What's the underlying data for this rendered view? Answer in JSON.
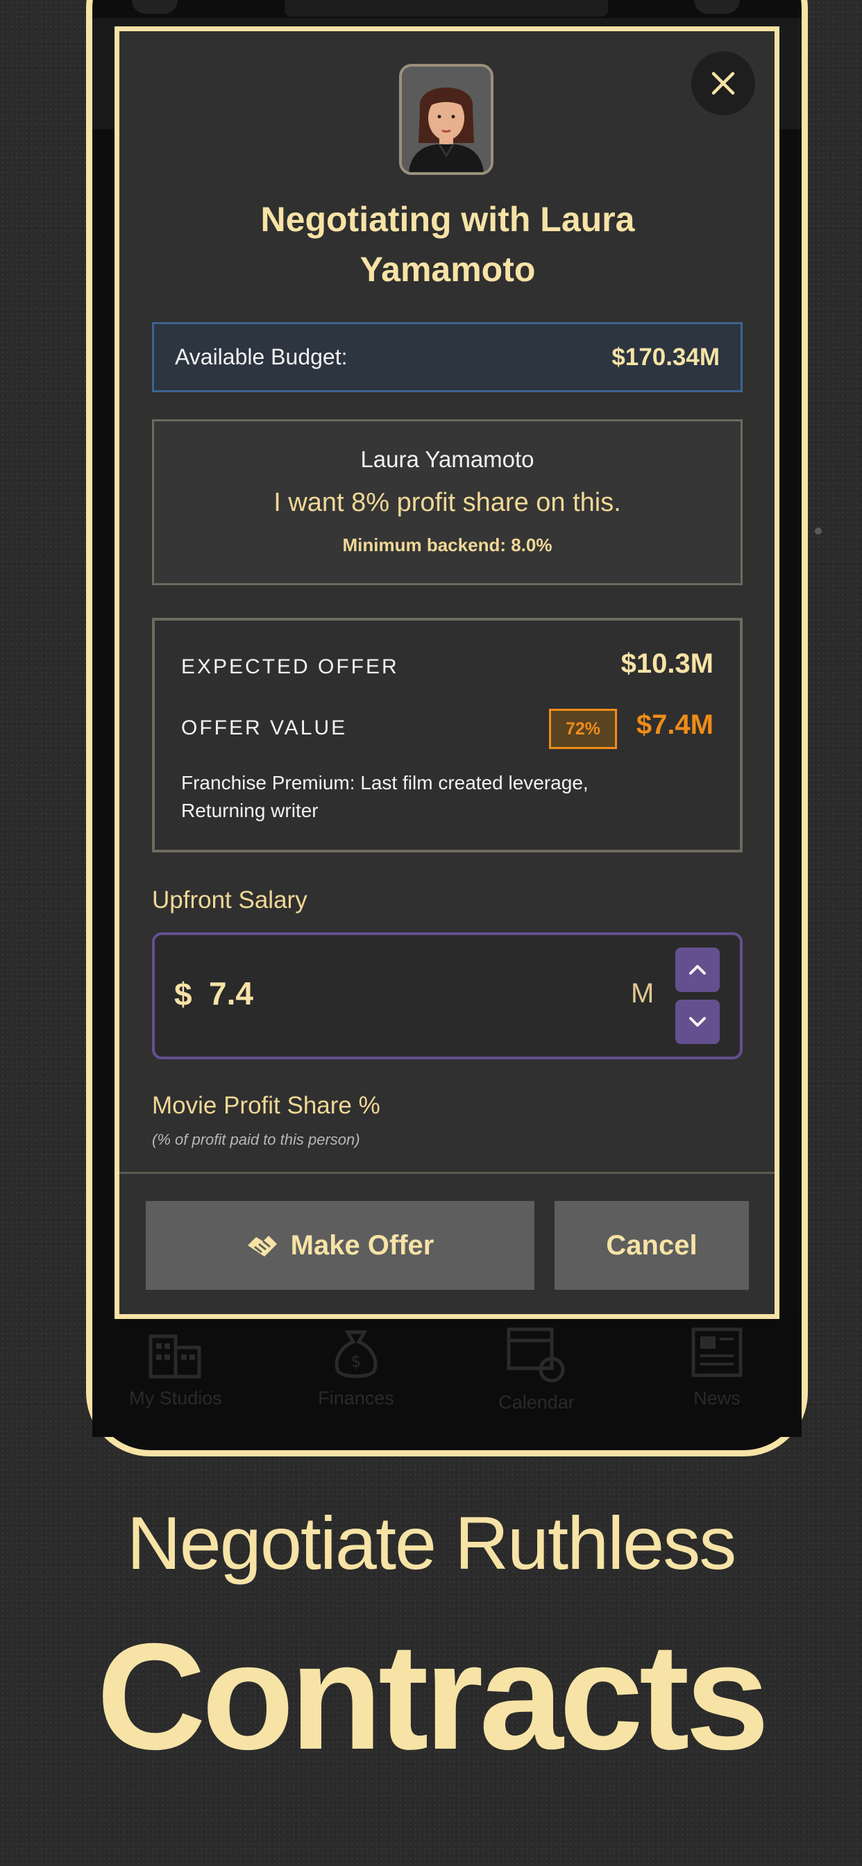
{
  "modal": {
    "title": "Negotiating with Laura Yamamoto",
    "budget": {
      "label": "Available Budget:",
      "value": "$170.34M"
    },
    "quote": {
      "name": "Laura Yamamoto",
      "text": "I want 8% profit share on this.",
      "minimum": "Minimum backend: 8.0%"
    },
    "offer": {
      "expected_label": "EXPECTED OFFER",
      "expected_value": "$10.3M",
      "value_label": "OFFER VALUE",
      "value_percent": "72%",
      "value_amount": "$7.4M",
      "premium_note": "Franchise Premium: Last film created leverage, Returning writer"
    },
    "salary": {
      "label": "Upfront Salary",
      "currency": "$",
      "value": "7.4",
      "unit": "M"
    },
    "profit_share": {
      "label": "Movie Profit Share %",
      "hint": "(% of profit paid to this person)"
    },
    "buttons": {
      "make_offer": "Make Offer",
      "cancel": "Cancel"
    }
  },
  "bottom_nav": [
    {
      "label": "My Studios",
      "icon": "building-icon"
    },
    {
      "label": "Finances",
      "icon": "money-bag-icon"
    },
    {
      "label": "Calendar",
      "icon": "calendar-icon"
    },
    {
      "label": "News",
      "icon": "newspaper-icon"
    }
  ],
  "promo": {
    "line1": "Negotiate Ruthless",
    "line2": "Contracts"
  },
  "colors": {
    "accent": "#f7e3a6",
    "offer_orange": "#ef8c18",
    "purple": "#65508f",
    "budget_blue": "#3d6390"
  }
}
